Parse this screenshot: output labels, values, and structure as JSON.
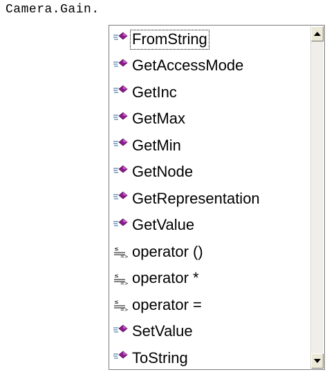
{
  "editor": {
    "code_text": "Camera.Gain."
  },
  "completion": {
    "items": [
      {
        "label": "FromString",
        "icon": "method-icon",
        "selected": true
      },
      {
        "label": "GetAccessMode",
        "icon": "method-icon"
      },
      {
        "label": "GetInc",
        "icon": "method-icon"
      },
      {
        "label": "GetMax",
        "icon": "method-icon"
      },
      {
        "label": "GetMin",
        "icon": "method-icon"
      },
      {
        "label": "GetNode",
        "icon": "method-icon"
      },
      {
        "label": "GetRepresentation",
        "icon": "method-icon"
      },
      {
        "label": "GetValue",
        "icon": "method-icon"
      },
      {
        "label": "operator ()",
        "icon": "operator-icon"
      },
      {
        "label": "operator *",
        "icon": "operator-icon"
      },
      {
        "label": "operator =",
        "icon": "operator-icon"
      },
      {
        "label": "SetValue",
        "icon": "method-icon"
      },
      {
        "label": "ToString",
        "icon": "method-icon"
      }
    ]
  },
  "colors": {
    "method_icon": "#8b1a8b",
    "border": "#7a7a7a"
  }
}
